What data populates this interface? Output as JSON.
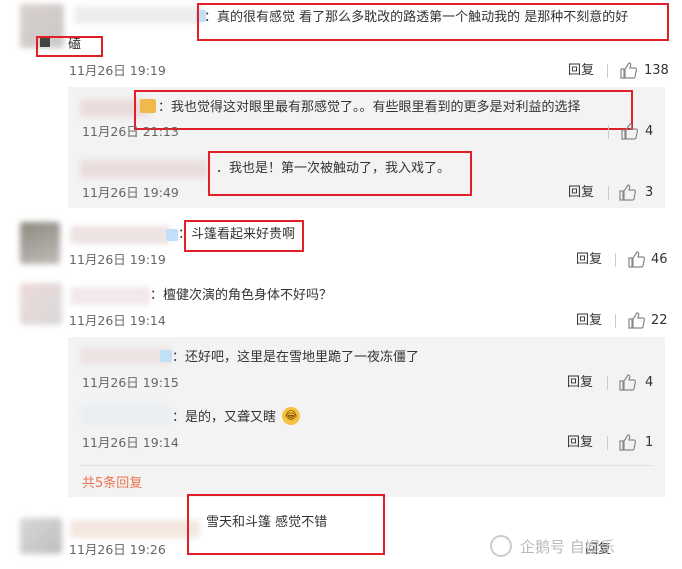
{
  "comments": [
    {
      "text": "：真的很有感觉 看了那么多耽改的路透第一个触动我的 是那种不刻意的好",
      "suffix": "磕",
      "time": "11月26日 19:19",
      "reply": "回复",
      "likes": "138"
    },
    {
      "text": "：我也觉得这对眼里最有那感觉了。。有些眼里看到的更多是对利益的选择",
      "time": "11月26日 21:13",
      "likes": "4"
    },
    {
      "text": "．我也是！第一次被触动了，我入戏了。",
      "time": "11月26日 19:49",
      "reply": "回复",
      "likes": "3"
    },
    {
      "text": "：斗篷看起来好贵啊",
      "time": "11月26日 19:19",
      "reply": "回复",
      "likes": "46"
    },
    {
      "text": "：檀健次演的角色身体不好吗？",
      "time": "11月26日 19:14",
      "reply": "回复",
      "likes": "22"
    },
    {
      "text": "：还好吧，这里是在雪地里跪了一夜冻僵了",
      "time": "11月26日 19:15",
      "reply": "回复",
      "likes": "4"
    },
    {
      "text": "：是的，又聋又瞎",
      "time": "11月26日 19:14",
      "reply": "回复",
      "likes": "1"
    },
    {
      "text": "雪天和斗篷 感觉不错",
      "time": "11月26日 19:26",
      "reply": "回复"
    }
  ],
  "more_replies": "共5条回复",
  "watermark": "企鹅号 自娱乐",
  "colors": {
    "highlight": "#e21f26",
    "link": "#eb7350",
    "panel": "#f3f3f3"
  }
}
